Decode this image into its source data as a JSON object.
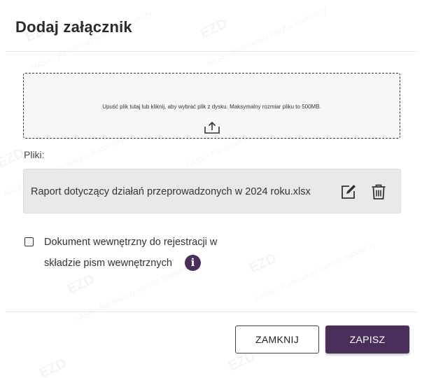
{
  "dialog": {
    "title": "Dodaj załącznik"
  },
  "dropzone": {
    "text": "Upuść plik tutaj lub kliknij, aby wybrać plik z dysku. Maksymalny rozmiar pliku to 500MB.",
    "icon": "upload-icon"
  },
  "files": {
    "label": "Pliki:",
    "items": [
      {
        "name": "Raport dotyczący działań przeprowadzonych w 2024 roku.xlsx",
        "edit_icon": "edit-icon",
        "delete_icon": "trash-icon"
      }
    ]
  },
  "internal_document": {
    "checked": false,
    "label_line1": "Dokument wewnętrzny do rejestracji w",
    "label_line2": "składzie pism wewnętrznych",
    "info_glyph": "i"
  },
  "buttons": {
    "close_label": "ZAMKNIJ",
    "save_label": "ZAPISZ"
  },
  "watermark": {
    "logo": "EZD",
    "text": "NASK - Państwowy Instytut Badawczy"
  },
  "colors": {
    "accent": "#4a2f5a",
    "dropzone_bg": "#f7f7f7",
    "file_row_bg": "#e9e9e9"
  }
}
